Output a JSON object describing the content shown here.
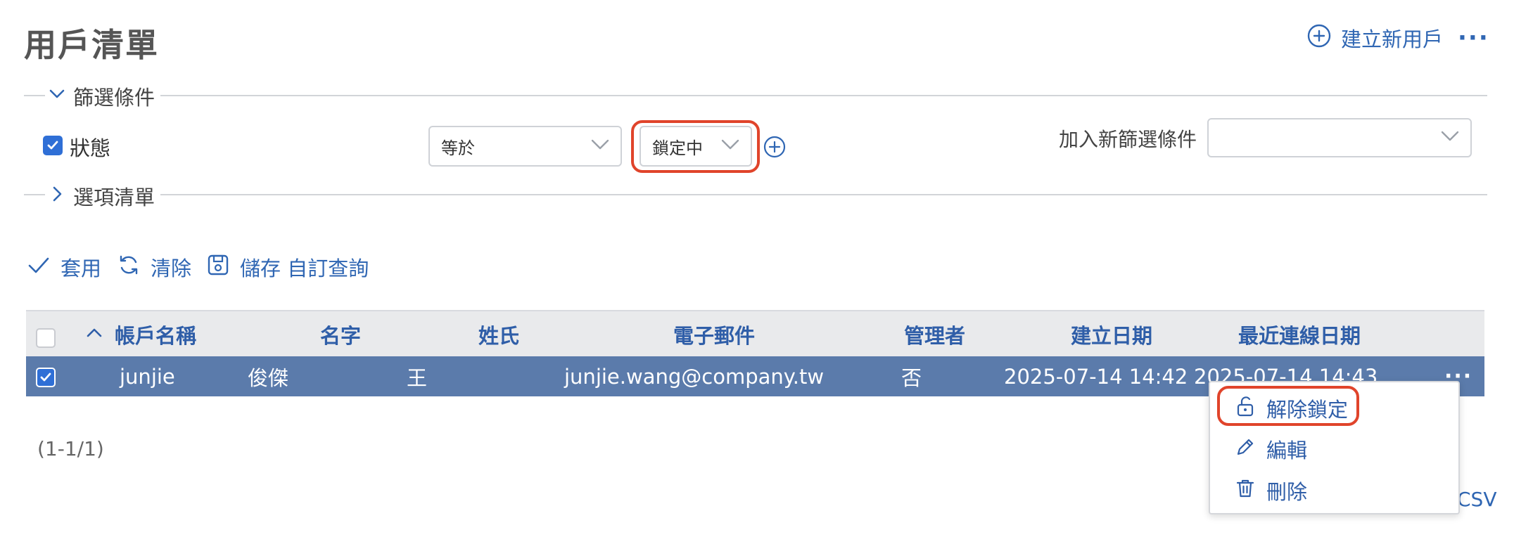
{
  "header": {
    "title": "用戶清單",
    "create_user_label": "建立新用戶",
    "more_label": "···"
  },
  "filters": {
    "section_label": "篩選條件",
    "condition": {
      "field_label": "狀態",
      "checked": true,
      "operator_value": "等於",
      "value": "鎖定中"
    },
    "new_filter_label": "加入新篩選條件",
    "new_filter_value": ""
  },
  "options": {
    "section_label": "選項清單"
  },
  "actions": {
    "apply_label": "套用",
    "clear_label": "清除",
    "save_label": "儲存 自訂查詢"
  },
  "table": {
    "columns": [
      "帳戶名稱",
      "名字",
      "姓氏",
      "電子郵件",
      "管理者",
      "建立日期",
      "最近連線日期"
    ],
    "sort_column": "帳戶名稱",
    "rows": [
      {
        "selected": true,
        "account": "junjie",
        "first_name": "俊傑",
        "last_name": "王",
        "email": "junjie.wang@company.tw",
        "admin": "否",
        "created": "2025-07-14 14:42",
        "last_login": "2025-07-14 14:43"
      }
    ]
  },
  "pager": {
    "range_text": "(1-1/1)"
  },
  "export": {
    "csv_partial": "CSV"
  },
  "row_menu": {
    "items": [
      {
        "label": "解除鎖定",
        "icon": "unlock-icon"
      },
      {
        "label": "編輯",
        "icon": "pencil-icon"
      },
      {
        "label": "刪除",
        "icon": "trash-icon"
      }
    ]
  },
  "colors": {
    "accent": "#2f66b3",
    "row_selected": "#5b7bab",
    "highlight": "#e0442b",
    "checkbox": "#2f6fd6"
  }
}
